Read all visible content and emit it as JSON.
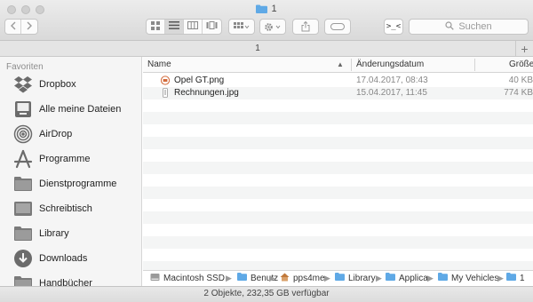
{
  "window": {
    "title": "1",
    "tab_label": "1",
    "new_tab_label": "+"
  },
  "toolbar": {
    "back_icon": "chevron-left-icon",
    "forward_icon": "chevron-right-icon",
    "view_modes": [
      "icon-view",
      "list-view",
      "column-view",
      "cover-flow-view"
    ],
    "active_view": "list-view",
    "group_icon": "grid-icon",
    "action_icon": "gear-icon",
    "share_icon": "share-icon",
    "tag_icon": "tag-icon",
    "terminal_label": ">_<",
    "search_placeholder": "Suchen"
  },
  "sidebar": {
    "heading": "Favoriten",
    "items": [
      {
        "label": "Dropbox",
        "icon": "dropbox-icon"
      },
      {
        "label": "Alle meine Dateien",
        "icon": "all-files-icon"
      },
      {
        "label": "AirDrop",
        "icon": "airdrop-icon"
      },
      {
        "label": "Programme",
        "icon": "applications-icon"
      },
      {
        "label": "Dienstprogramme",
        "icon": "folder-icon"
      },
      {
        "label": "Schreibtisch",
        "icon": "desktop-icon"
      },
      {
        "label": "Library",
        "icon": "folder-icon"
      },
      {
        "label": "Downloads",
        "icon": "downloads-icon"
      },
      {
        "label": "Handbücher",
        "icon": "folder-icon"
      }
    ]
  },
  "columns": {
    "name": "Name",
    "date": "Änderungsdatum",
    "size": "Größe"
  },
  "files": [
    {
      "name": "Opel GT.png",
      "date": "17.04.2017, 08:43",
      "size": "40 KB",
      "icon": "png-file-icon"
    },
    {
      "name": "Rechnungen.jpg",
      "date": "15.04.2017, 11:45",
      "size": "774 KB",
      "icon": "jpg-file-icon"
    }
  ],
  "path": [
    {
      "label": "Macintosh SSD",
      "icon": "disk-icon"
    },
    {
      "label": "Benutz",
      "icon": "folder-icon"
    },
    {
      "label": "pps4me",
      "icon": "home-icon"
    },
    {
      "label": "Library",
      "icon": "folder-icon"
    },
    {
      "label": "Applica",
      "icon": "folder-icon"
    },
    {
      "label": "My Vehicles",
      "icon": "folder-icon"
    },
    {
      "label": "1",
      "icon": "folder-icon"
    }
  ],
  "status": "2 Objekte, 232,35 GB verfügbar",
  "colors": {
    "folder_blue": "#5fa9e6",
    "sidebar_icon": "#6b6b6b",
    "row_alt": "#f4f5f5"
  }
}
